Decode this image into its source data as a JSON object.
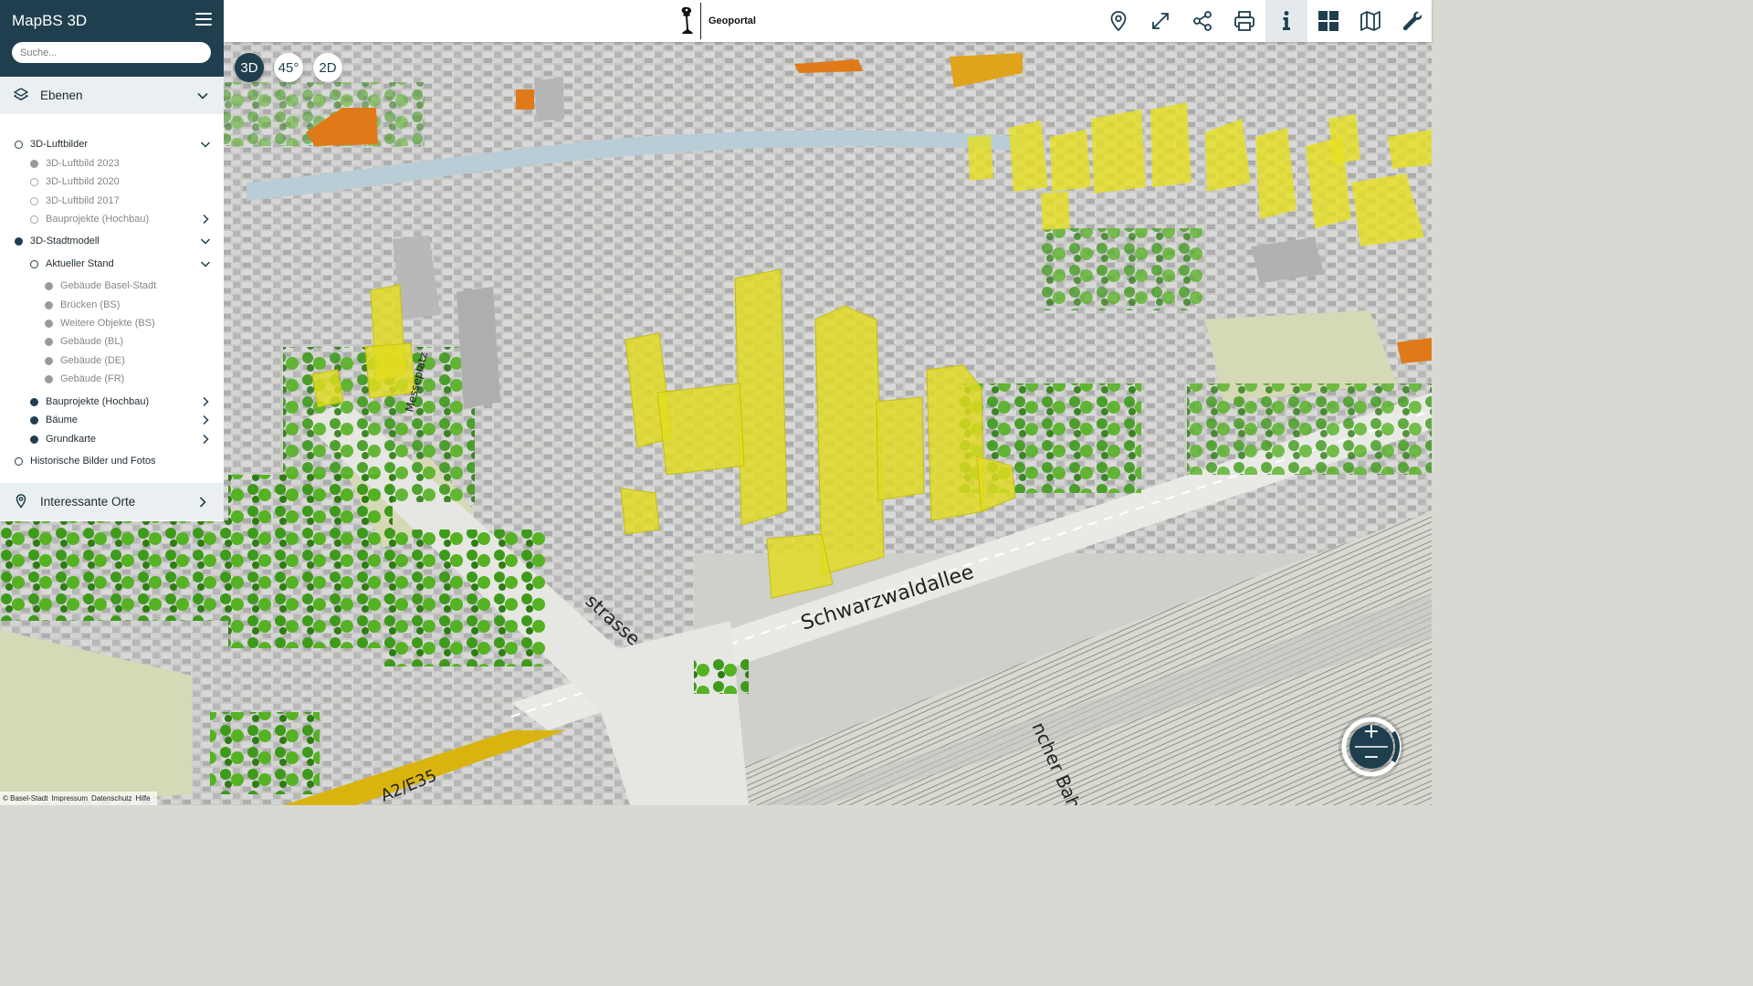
{
  "app": {
    "title": "MapBS 3D"
  },
  "header": {
    "brand_title": "Geoportal"
  },
  "search": {
    "placeholder": "Suche..."
  },
  "toolbar": {
    "items": [
      {
        "icon": "location-pin-icon",
        "active": false
      },
      {
        "icon": "expand-icon",
        "active": false
      },
      {
        "icon": "share-icon",
        "active": false
      },
      {
        "icon": "print-icon",
        "active": false
      },
      {
        "icon": "info-icon",
        "active": true
      },
      {
        "icon": "grid-icon",
        "active": false
      },
      {
        "icon": "map-icon",
        "active": false
      },
      {
        "icon": "wrench-icon",
        "active": false
      }
    ]
  },
  "view_modes": {
    "items": [
      {
        "label": "3D",
        "active": true
      },
      {
        "label": "45°",
        "active": false
      },
      {
        "label": "2D",
        "active": false
      }
    ]
  },
  "sections": {
    "layers": {
      "label": "Ebenen",
      "icon": "layers-icon"
    },
    "places": {
      "label": "Interessante Orte",
      "icon": "location-pin-icon"
    }
  },
  "layers": {
    "items": [
      {
        "label": "3D-Luftbilder",
        "state": "off",
        "style": "dark",
        "level": 0,
        "expander": "down"
      },
      {
        "label": "3D-Luftbild 2023",
        "state": "grey-on",
        "style": "grey",
        "level": 1,
        "expander": ""
      },
      {
        "label": "3D-Luftbild 2020",
        "state": "grey-off",
        "style": "grey",
        "level": 1,
        "expander": ""
      },
      {
        "label": "3D-Luftbild 2017",
        "state": "grey-off",
        "style": "grey",
        "level": 1,
        "expander": ""
      },
      {
        "label": "Bauprojekte (Hochbau)",
        "state": "grey-off",
        "style": "grey",
        "level": 1,
        "expander": "right"
      },
      {
        "label": "3D-Stadtmodell",
        "state": "on",
        "style": "dark",
        "level": 0,
        "expander": "down"
      },
      {
        "label": "Aktueller Stand",
        "state": "off",
        "style": "dark",
        "level": 1,
        "expander": "down"
      },
      {
        "label": "Gebäude Basel-Stadt",
        "state": "grey-on",
        "style": "grey",
        "level": 2,
        "expander": ""
      },
      {
        "label": "Brücken (BS)",
        "state": "grey-on",
        "style": "grey",
        "level": 2,
        "expander": ""
      },
      {
        "label": "Weitere Objekte (BS)",
        "state": "grey-on",
        "style": "grey",
        "level": 2,
        "expander": ""
      },
      {
        "label": "Gebäude (BL)",
        "state": "grey-on",
        "style": "grey",
        "level": 2,
        "expander": ""
      },
      {
        "label": "Gebäude (DE)",
        "state": "grey-on",
        "style": "grey",
        "level": 2,
        "expander": ""
      },
      {
        "label": "Gebäude (FR)",
        "state": "grey-on",
        "style": "grey",
        "level": 2,
        "expander": ""
      },
      {
        "label": "Bauprojekte (Hochbau)",
        "state": "on",
        "style": "dark",
        "level": 1,
        "expander": "right"
      },
      {
        "label": "Bäume",
        "state": "on",
        "style": "dark",
        "level": 1,
        "expander": "right"
      },
      {
        "label": "Grundkarte",
        "state": "on",
        "style": "dark",
        "level": 1,
        "expander": "right"
      },
      {
        "label": "Historische Bilder und Fotos",
        "state": "off",
        "style": "dark",
        "level": 0,
        "expander": ""
      }
    ]
  },
  "map": {
    "street_labels": [
      "Schwarzwaldallee",
      "Messeplatz",
      "strasse",
      "ncher Bahn",
      "A2/E35"
    ],
    "colors": {
      "projects": "#e2dc1e",
      "greenery": "#3f9a1c",
      "buildings": "#bfbfbf",
      "water": "#b9cdd7",
      "orange_buildings": "#e07a18"
    }
  },
  "zoom": {
    "in_label": "+",
    "out_label": "−"
  },
  "footer": {
    "copyright": "© Basel-Stadt",
    "links": [
      "Impressum",
      "Datenschutz",
      "Hilfe"
    ]
  }
}
